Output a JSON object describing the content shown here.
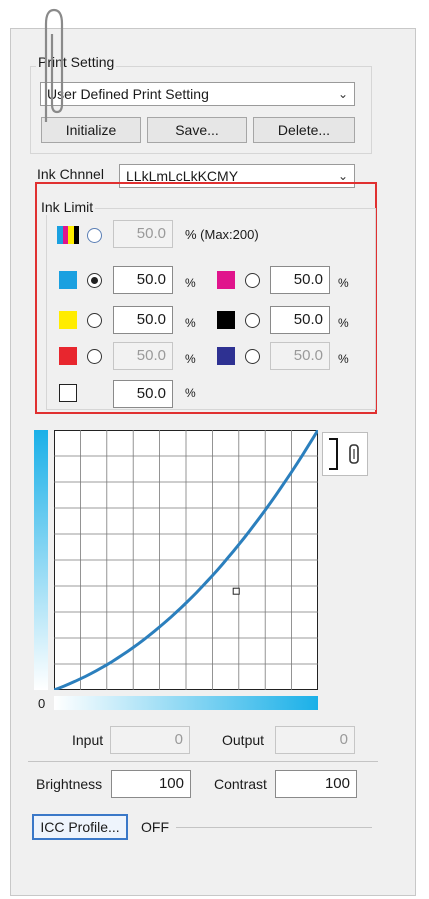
{
  "print_setting": {
    "group_title": "Print Setting",
    "selected": "User Defined Print Setting",
    "initialize_label": "Initialize",
    "save_label": "Save...",
    "delete_label": "Delete..."
  },
  "ink_channel": {
    "label": "Ink Chnnel",
    "selected": "LLkLmLcLkKCMY"
  },
  "ink_limit": {
    "group_title": "Ink Limit",
    "total": {
      "value": "50.0",
      "suffix": "% (Max:200)"
    },
    "channels": [
      {
        "name": "cyan",
        "color": "#1aa0e0",
        "value": "50.0",
        "enabled": true,
        "selected": true
      },
      {
        "name": "magenta",
        "color": "#e0148c",
        "value": "50.0",
        "enabled": true,
        "selected": false
      },
      {
        "name": "yellow",
        "color": "#ffec00",
        "value": "50.0",
        "enabled": true,
        "selected": false
      },
      {
        "name": "black",
        "color": "#000000",
        "value": "50.0",
        "enabled": true,
        "selected": false
      },
      {
        "name": "red",
        "color": "#e8262e",
        "value": "50.0",
        "enabled": false,
        "selected": false
      },
      {
        "name": "blue",
        "color": "#2e3192",
        "value": "50.0",
        "enabled": false,
        "selected": false
      },
      {
        "name": "white",
        "color": "#ffffff",
        "value": "50.0",
        "enabled": true,
        "selected": false
      }
    ],
    "percent_sign": "%"
  },
  "curve": {
    "origin_label": "0",
    "line_color": "#2b7fbd",
    "control_point": {
      "input": 0.69,
      "output": 0.38
    }
  },
  "io": {
    "input_label": "Input",
    "input_value": "0",
    "output_label": "Output",
    "output_value": "0"
  },
  "adjust": {
    "brightness_label": "Brightness",
    "brightness_value": "100",
    "contrast_label": "Contrast",
    "contrast_value": "100"
  },
  "icc": {
    "button_label": "ICC Profile...",
    "status": "OFF"
  }
}
